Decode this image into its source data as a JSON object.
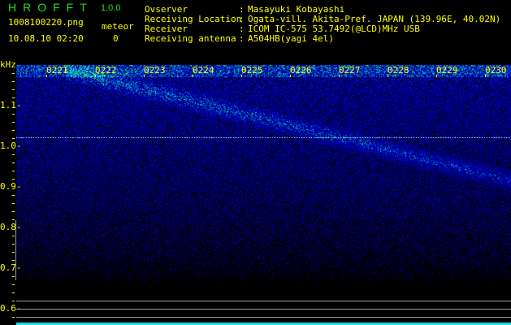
{
  "header": {
    "app_title": "HROFFT",
    "version": "1.0.0",
    "file_name": "1008100220.png",
    "datetime": "10.08.10 02:20",
    "meteor_label": "meteor",
    "meteor_count": "0"
  },
  "info": [
    {
      "label": "Ovserver",
      "value": "Masayuki Kobayashi"
    },
    {
      "label": "Receiving Location",
      "value": "Ogata-vill. Akita-Pref. JAPAN (139.96E, 40.02N)"
    },
    {
      "label": "Receiver",
      "value": "ICOM IC-575 53.7492(@LCD)MHz USB"
    },
    {
      "label": "Receiving antenna",
      "value": "A504HB(yagi 4el)"
    }
  ],
  "chart_data": {
    "type": "heatmap",
    "ylabel": "kHz",
    "ylim": [
      0.6,
      1.2
    ],
    "y_ticks": [
      "1.1",
      "1.0",
      "0.9",
      "0.8",
      "0.7",
      "0.6"
    ],
    "x_ticks": [
      "0221",
      "0222",
      "0223",
      "0224",
      "0225",
      "0226",
      "0227",
      "0228",
      "0229",
      "0230"
    ],
    "colors": {
      "background": "#000000",
      "low": "#0010a0",
      "mid": "#1060ff",
      "high": "#30e0c0",
      "labels": "#ffff00"
    }
  }
}
